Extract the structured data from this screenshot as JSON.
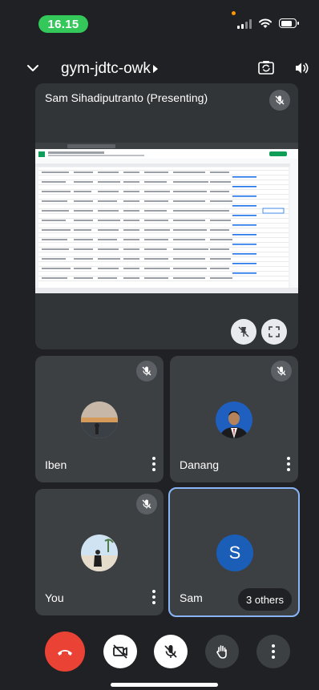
{
  "status_bar": {
    "time": "16.15",
    "time_pill_color": "#34c759",
    "icons": [
      "signal-icon",
      "wifi-icon",
      "battery-icon"
    ]
  },
  "header": {
    "meeting_code": "gym-jdtc-owk",
    "icons": [
      "chevron-down-icon",
      "chevron-right-icon",
      "switch-camera-icon",
      "speaker-icon"
    ]
  },
  "presenter": {
    "label": "Sam Sihadiputranto (Presenting)",
    "content": "shared spreadsheet screen"
  },
  "participants": [
    {
      "name": "Iben",
      "muted": true,
      "avatar": "photo"
    },
    {
      "name": "Danang",
      "muted": true,
      "avatar": "photo"
    },
    {
      "name": "You",
      "muted": true,
      "avatar": "photo"
    },
    {
      "name": "Sam",
      "muted": false,
      "avatar_initial": "S",
      "avatar_color": "#1a5eb8",
      "overflow": "3 others",
      "active_speaker": true
    }
  ],
  "controls": [
    {
      "name": "end-call",
      "icon": "hang-up-icon",
      "color": "#ea4335"
    },
    {
      "name": "camera",
      "icon": "camera-off-icon",
      "state": "off"
    },
    {
      "name": "microphone",
      "icon": "mic-off-icon",
      "state": "off"
    },
    {
      "name": "raise-hand",
      "icon": "hand-icon"
    },
    {
      "name": "more",
      "icon": "more-vert-icon"
    }
  ],
  "colors": {
    "background": "#202124",
    "tile": "#3c4043",
    "active_border": "#8ab4f8"
  }
}
